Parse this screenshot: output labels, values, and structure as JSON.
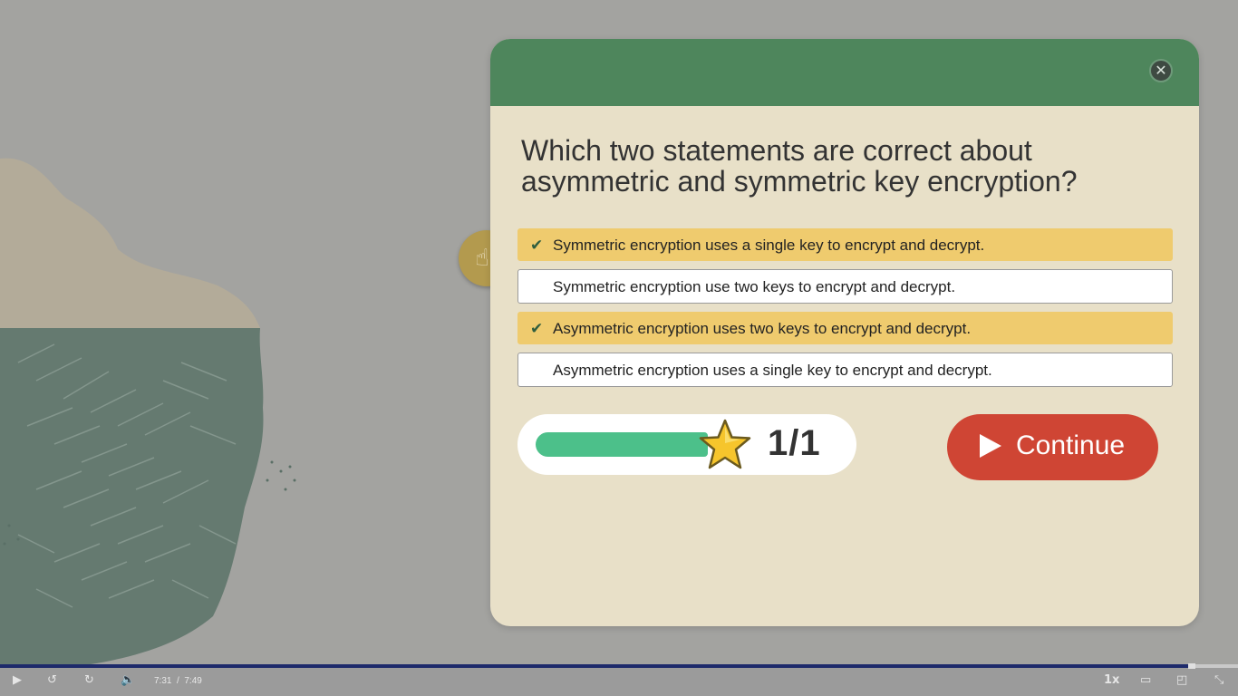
{
  "question": {
    "text": "Which two statements are correct about asymmetric and symmetric key encryption?"
  },
  "options": [
    {
      "label": "Symmetric encryption uses a single key to encrypt and decrypt.",
      "selected": true
    },
    {
      "label": "Symmetric encryption use two keys to encrypt and decrypt.",
      "selected": false
    },
    {
      "label": "Asymmetric encryption uses two keys to encrypt and decrypt.",
      "selected": true
    },
    {
      "label": "Asymmetric encryption uses a single key to encrypt and decrypt.",
      "selected": false
    }
  ],
  "score": {
    "text": "1/1",
    "progress": 0.95
  },
  "continue_button": {
    "label": "Continue"
  },
  "player": {
    "current_time": "7:31",
    "separator": "/",
    "total_time": "7:49",
    "speed": "1x",
    "seek_progress": 0.963
  },
  "colors": {
    "header": "#4e865c",
    "modal_bg": "#e8e0c8",
    "selected_option": "#efcb6e",
    "continue": "#cf4534",
    "progress": "#4cc08a"
  },
  "icons": [
    "close-icon",
    "check-icon",
    "star-icon",
    "play-icon",
    "hand-icon",
    "rewind-10-icon",
    "forward-10-icon",
    "volume-icon",
    "captions-icon",
    "picture-in-picture-icon",
    "exit-fullscreen-icon"
  ]
}
